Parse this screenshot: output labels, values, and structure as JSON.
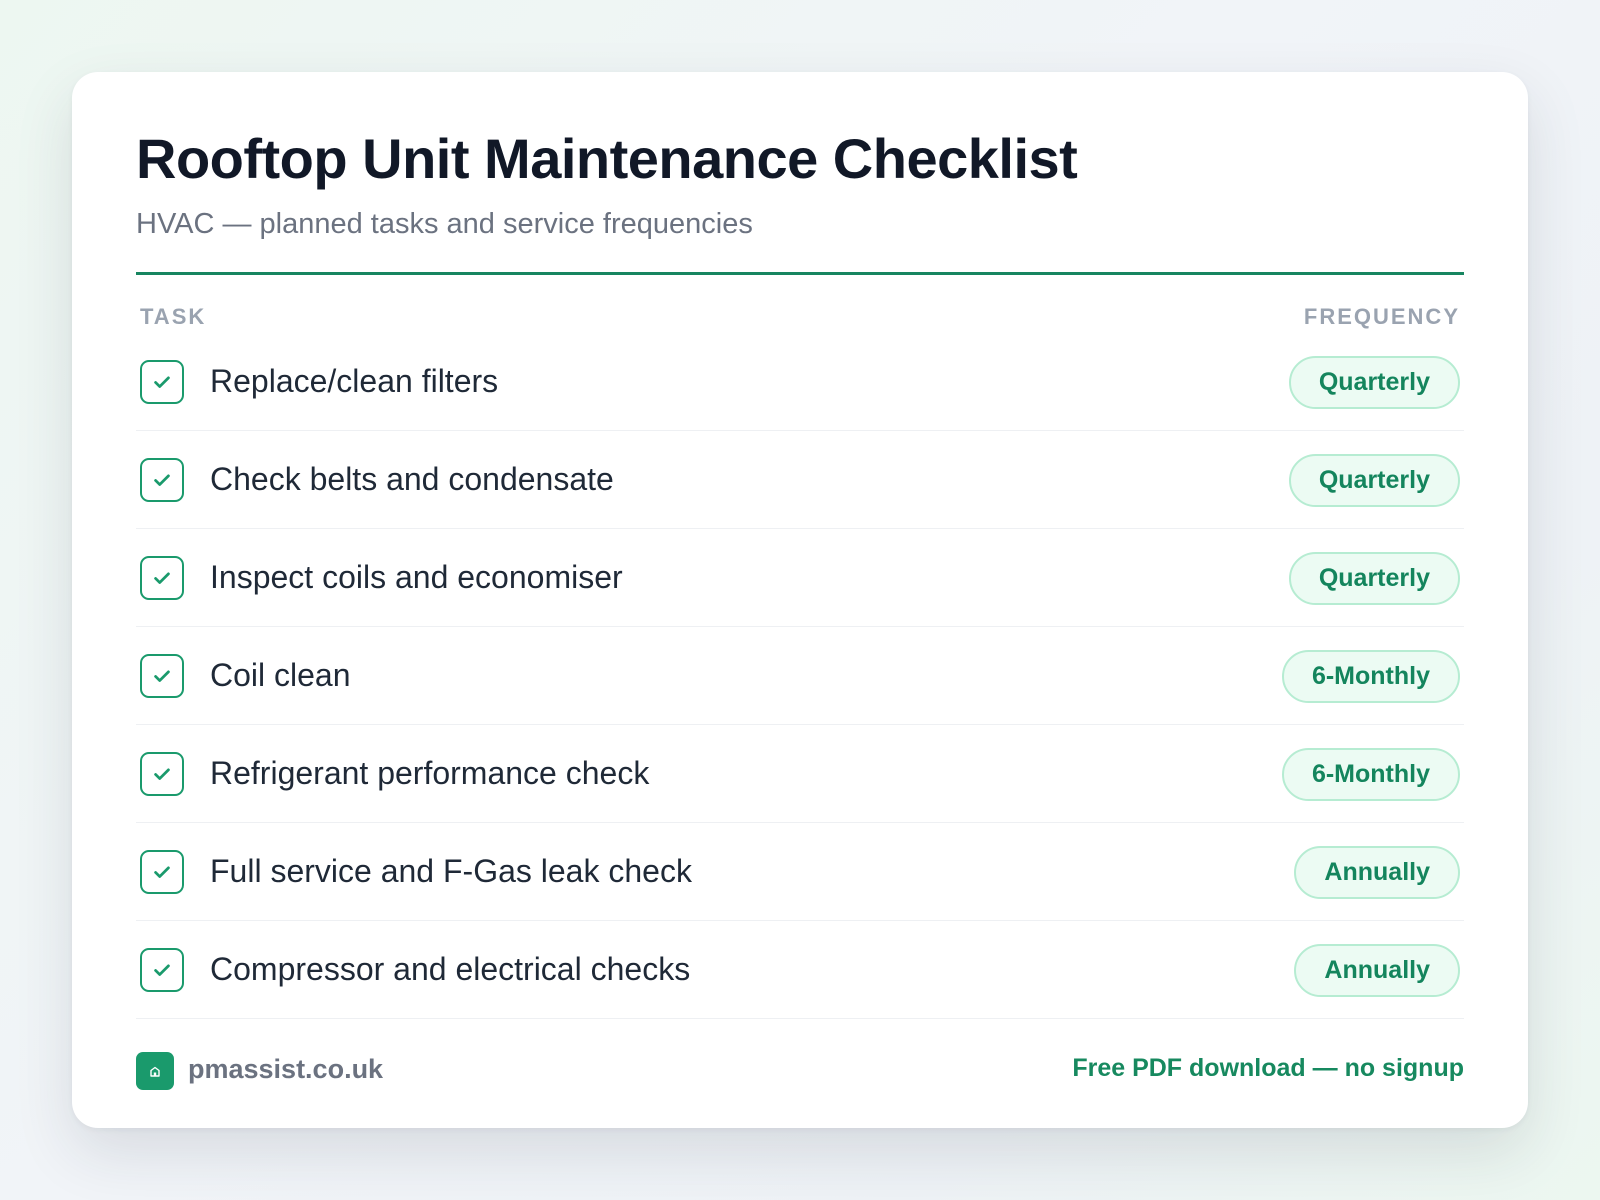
{
  "document": {
    "title": "Rooftop Unit Maintenance Checklist",
    "subtitle": "HVAC — planned tasks and service frequencies"
  },
  "columns": {
    "task": "TASK",
    "frequency": "FREQUENCY"
  },
  "tasks": [
    {
      "label": "Replace/clean filters",
      "frequency": "Quarterly",
      "checked": true
    },
    {
      "label": "Check belts and condensate",
      "frequency": "Quarterly",
      "checked": true
    },
    {
      "label": "Inspect coils and economiser",
      "frequency": "Quarterly",
      "checked": true
    },
    {
      "label": "Coil clean",
      "frequency": "6-Monthly",
      "checked": true
    },
    {
      "label": "Refrigerant performance check",
      "frequency": "6-Monthly",
      "checked": true
    },
    {
      "label": "Full service and F-Gas leak check",
      "frequency": "Annually",
      "checked": true
    },
    {
      "label": "Compressor and electrical checks",
      "frequency": "Annually",
      "checked": true
    }
  ],
  "footer": {
    "site": "pmassist.co.uk",
    "cta": "Free PDF download — no signup",
    "logo_icon": "house-icon"
  },
  "colors": {
    "accent": "#1a9a6c",
    "badge_bg": "#ecfbf3",
    "title": "#111827"
  }
}
